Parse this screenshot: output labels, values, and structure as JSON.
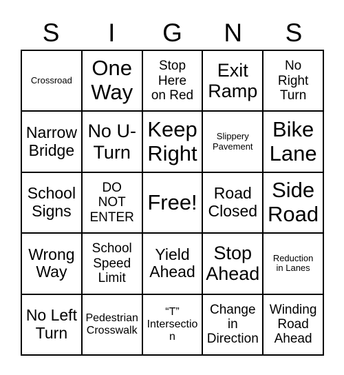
{
  "card": {
    "title_letters": [
      "S",
      "I",
      "G",
      "N",
      "S"
    ],
    "rows": [
      [
        {
          "label": "Crossroad",
          "size": "xs"
        },
        {
          "label": "One\nWay",
          "size": "xxl"
        },
        {
          "label": "Stop\nHere\non Red",
          "size": "md"
        },
        {
          "label": "Exit\nRamp",
          "size": "xl"
        },
        {
          "label": "No\nRight\nTurn",
          "size": "md"
        }
      ],
      [
        {
          "label": "Narrow\nBridge",
          "size": "lg"
        },
        {
          "label": "No U-\nTurn",
          "size": "xl"
        },
        {
          "label": "Keep\nRight",
          "size": "xxl"
        },
        {
          "label": "Slippery\nPavement",
          "size": "xs"
        },
        {
          "label": "Bike\nLane",
          "size": "xxl"
        }
      ],
      [
        {
          "label": "School\nSigns",
          "size": "lg"
        },
        {
          "label": "DO\nNOT\nENTER",
          "size": "md"
        },
        {
          "label": "Free!",
          "size": "xxl"
        },
        {
          "label": "Road\nClosed",
          "size": "lg"
        },
        {
          "label": "Side\nRoad",
          "size": "xxl"
        }
      ],
      [
        {
          "label": "Wrong\nWay",
          "size": "lg"
        },
        {
          "label": "School\nSpeed\nLimit",
          "size": "md"
        },
        {
          "label": "Yield\nAhead",
          "size": "lg"
        },
        {
          "label": "Stop\nAhead",
          "size": "xl"
        },
        {
          "label": "Reduction\nin Lanes",
          "size": "xs"
        }
      ],
      [
        {
          "label": "No Left\nTurn",
          "size": "lg"
        },
        {
          "label": "Pedestrian\nCrosswalk",
          "size": "sm"
        },
        {
          "label": "“T”\nIntersection",
          "size": "sm"
        },
        {
          "label": "Change\nin\nDirection",
          "size": "md"
        },
        {
          "label": "Winding\nRoad\nAhead",
          "size": "md"
        }
      ]
    ],
    "colors": {
      "border": "#000000",
      "text": "#000000",
      "background": "#ffffff"
    }
  }
}
